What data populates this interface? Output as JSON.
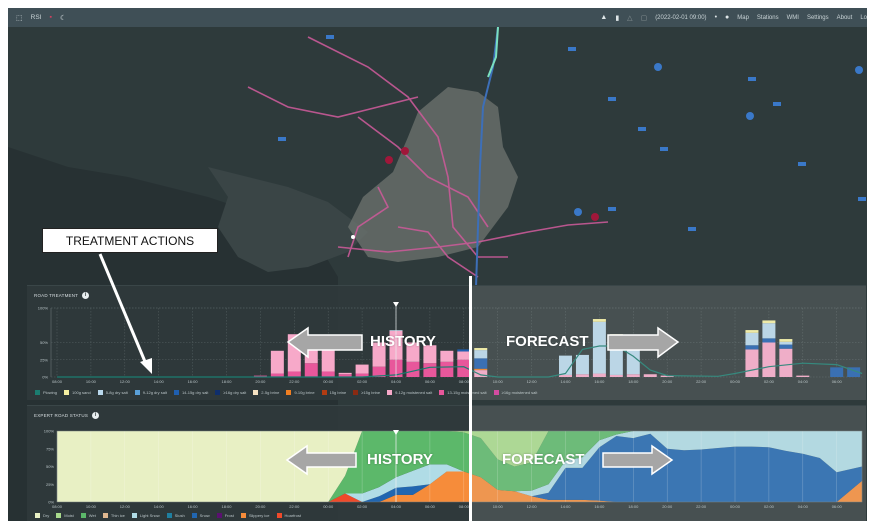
{
  "topbar": {
    "app_name": "RSI",
    "station_time": "(2022-02-01 09:00)",
    "nav": [
      "Map",
      "Stations",
      "WMI",
      "Settings",
      "About",
      "Lo"
    ],
    "icons": [
      "rsi-logo-icon",
      "flag-icon",
      "moon-icon",
      "car-icon",
      "truck-icon",
      "warning-icon",
      "calendar-icon",
      "dot-icon",
      "globe-icon"
    ]
  },
  "annotations": {
    "callout": "TREATMENT ACTIONS",
    "history": "HISTORY",
    "forecast": "FORECAST"
  },
  "chart_data": [
    {
      "type": "bar",
      "title": "ROAD TREATMENT",
      "stacked": true,
      "x_ticks": [
        "08:00",
        "10:00",
        "12:00",
        "14:00",
        "16:00",
        "18:00",
        "20:00",
        "22:00",
        "00:00",
        "02:00",
        "04:00",
        "06:00",
        "08:00",
        "10:00",
        "12:00",
        "14:00",
        "16:00",
        "18:00",
        "20:00",
        "22:00",
        "00:00",
        "02:00",
        "04:00",
        "06:00"
      ],
      "y_ticks": [
        "0%",
        "25%",
        "50%",
        "100%"
      ],
      "ylim": [
        0,
        100
      ],
      "grid": true,
      "now_marker": "04:00",
      "legend": [
        {
          "name": "Plowing",
          "color": "#1b7d70"
        },
        {
          "name": "100g sand",
          "color": "#f6f0a2"
        },
        {
          "name": "5-8g dry salt",
          "color": "#b9d8ec"
        },
        {
          "name": "9-12g dry salt",
          "color": "#5aa0d8"
        },
        {
          "name": "14-15g dry salt",
          "color": "#1f5fb0"
        },
        {
          "name": "≥16g dry salt",
          "color": "#0f2e6c"
        },
        {
          "name": "2-5g brine",
          "color": "#f5e2c2"
        },
        {
          "name": "9-10g brine",
          "color": "#f07f22"
        },
        {
          "name": "15g brine",
          "color": "#b23c12"
        },
        {
          "name": "≥15g brine",
          "color": "#8a2a12"
        },
        {
          "name": "9-12g moistened salt",
          "color": "#f7a9c9"
        },
        {
          "name": "13-15g moistened salt",
          "color": "#e8579b"
        },
        {
          "name": "≥16g moistened salt",
          "color": "#d6349a"
        }
      ],
      "bars": [
        {
          "time": "20:00",
          "h": 12,
          "seg": {
            "13-15g moistened salt": 2
          }
        },
        {
          "time": "21:00",
          "h": 13,
          "seg": {
            "13-15g moistened salt": 5,
            "9-12g moistened salt": 33
          }
        },
        {
          "time": "22:00",
          "h": 14,
          "seg": {
            "13-15g moistened salt": 8,
            "9-12g moistened salt": 54
          }
        },
        {
          "time": "23:00",
          "h": 15,
          "seg": {
            "13-15g moistened salt": 20,
            "9-12g moistened salt": 28
          }
        },
        {
          "time": "00:00",
          "h": 16,
          "seg": {
            "13-15g moistened salt": 8,
            "9-12g moistened salt": 34
          }
        },
        {
          "time": "01:00",
          "h": 17,
          "seg": {
            "13-15g moistened salt": 4,
            "9-12g moistened salt": 2
          }
        },
        {
          "time": "02:00",
          "h": 18,
          "seg": {
            "13-15g moistened salt": 5,
            "9-12g moistened salt": 13
          }
        },
        {
          "time": "03:00",
          "h": 19,
          "seg": {
            "13-15g moistened salt": 15,
            "9-12g moistened salt": 35
          }
        },
        {
          "time": "04:00",
          "h": 20,
          "seg": {
            "13-15g moistened salt": 25,
            "9-12g moistened salt": 42,
            "5-8g dry salt": 1
          }
        },
        {
          "time": "05:00",
          "h": 21,
          "seg": {
            "13-15g moistened salt": 22,
            "9-12g moistened salt": 28
          }
        },
        {
          "time": "06:00",
          "h": 22,
          "seg": {
            "13-15g moistened salt": 20,
            "9-12g moistened salt": 26
          }
        },
        {
          "time": "07:00",
          "h": 23,
          "seg": {
            "13-15g moistened salt": 22,
            "9-12g moistened salt": 16
          }
        },
        {
          "time": "08:00",
          "h": 24,
          "seg": {
            "13-15g moistened salt": 25,
            "9-12g moistened salt": 12,
            "14-15g dry salt": 3
          }
        },
        {
          "time": "09:00",
          "h": 25,
          "seg": {
            "9-12g moistened salt": 10,
            "9-10g brine": 2,
            "14-15g dry salt": 15,
            "5-8g dry salt": 12,
            "100g sand": 3
          }
        },
        {
          "time": "14:00",
          "h": 30,
          "seg": {
            "9-12g moistened salt": 3,
            "5-8g dry salt": 28
          }
        },
        {
          "time": "15:00",
          "h": 31,
          "seg": {
            "9-12g moistened salt": 4,
            "5-8g dry salt": 28
          }
        },
        {
          "time": "16:00",
          "h": 32,
          "seg": {
            "9-12g moistened salt": 5,
            "5-8g dry salt": 75,
            "100g sand": 4
          }
        },
        {
          "time": "17:00",
          "h": 33,
          "seg": {
            "9-12g moistened salt": 3,
            "5-8g dry salt": 56,
            "100g sand": 3
          }
        },
        {
          "time": "18:00",
          "h": 34,
          "seg": {
            "9-12g moistened salt": 4,
            "5-8g dry salt": 46
          }
        },
        {
          "time": "19:00",
          "h": 35,
          "seg": {
            "9-12g moistened salt": 4
          }
        },
        {
          "time": "20:00",
          "h": 36,
          "seg": {
            "9-12g moistened salt": 2
          }
        },
        {
          "time": "01:00",
          "h": 41,
          "seg": {
            "9-12g moistened salt": 40,
            "14-15g dry salt": 6,
            "5-8g dry salt": 18,
            "100g sand": 4
          }
        },
        {
          "time": "02:00",
          "h": 42,
          "seg": {
            "9-12g moistened salt": 50,
            "14-15g dry salt": 6,
            "5-8g dry salt": 22,
            "100g sand": 4
          }
        },
        {
          "time": "03:00",
          "h": 43,
          "seg": {
            "9-12g moistened salt": 41,
            "14-15g dry salt": 6,
            "5-8g dry salt": 4,
            "100g sand": 4
          }
        },
        {
          "time": "04:00",
          "h": 44,
          "seg": {
            "9-12g moistened salt": 2
          }
        },
        {
          "time": "06:00",
          "h": 46,
          "seg": {
            "14-15g dry salt": 14
          }
        },
        {
          "time": "07:00",
          "h": 47,
          "seg": {
            "14-15g dry salt": 14
          }
        }
      ],
      "plowing_line": [
        [
          0,
          0
        ],
        [
          18,
          0
        ],
        [
          20,
          3
        ],
        [
          22,
          14
        ],
        [
          24,
          15
        ],
        [
          25,
          3
        ],
        [
          26,
          0
        ],
        [
          29,
          0
        ],
        [
          30,
          5
        ],
        [
          31,
          40
        ],
        [
          32,
          45
        ],
        [
          33,
          45
        ],
        [
          34,
          30
        ],
        [
          35,
          10
        ],
        [
          36,
          2
        ],
        [
          39,
          1
        ],
        [
          40,
          5
        ],
        [
          42,
          15
        ],
        [
          44,
          20
        ],
        [
          46,
          18
        ],
        [
          47.5,
          5
        ]
      ]
    },
    {
      "type": "area",
      "title": "EXPERT ROAD STATUS",
      "stacked": true,
      "ylim": [
        0,
        100
      ],
      "x_ticks": [
        "08:00",
        "10:00",
        "12:00",
        "14:00",
        "16:00",
        "18:00",
        "20:00",
        "22:00",
        "00:00",
        "02:00",
        "04:00",
        "06:00",
        "08:00",
        "10:00",
        "12:00",
        "14:00",
        "16:00",
        "18:00",
        "20:00",
        "22:00",
        "00:00",
        "02:00",
        "04:00",
        "06:00"
      ],
      "y_ticks": [
        "0%",
        "25%",
        "50%",
        "75%",
        "100%"
      ],
      "now_marker": "04:00",
      "legend": [
        {
          "name": "Dry",
          "color": "#e8f0c4"
        },
        {
          "name": "Moist",
          "color": "#a8da8c"
        },
        {
          "name": "Wet",
          "color": "#5cb86a"
        },
        {
          "name": "Thin ice",
          "color": "#e0b890"
        },
        {
          "name": "Light Snow",
          "color": "#b0dce6"
        },
        {
          "name": "Slush",
          "color": "#1f7fa0"
        },
        {
          "name": "Snow",
          "color": "#2166b0"
        },
        {
          "name": "Frost",
          "color": "#5a1070"
        },
        {
          "name": "Slippery ice",
          "color": "#f68c3a"
        },
        {
          "name": "Hoarfrost",
          "color": "#f04a2a"
        }
      ],
      "stack_order": [
        "Hoarfrost",
        "Slippery ice",
        "Snow",
        "Light Snow",
        "Wet",
        "Moist",
        "Dry"
      ],
      "points": [
        {
          "h": 0,
          "Dry": 100
        },
        {
          "h": 16,
          "Dry": 100
        },
        {
          "h": 17,
          "Hoarfrost": 12,
          "Wet": 25,
          "Dry": 63
        },
        {
          "h": 18,
          "Light Snow": 12,
          "Wet": 88
        },
        {
          "h": 19,
          "Snow": 8,
          "Light Snow": 13,
          "Wet": 79
        },
        {
          "h": 20,
          "Slippery ice": 10,
          "Snow": 10,
          "Light Snow": 15,
          "Wet": 65
        },
        {
          "h": 21,
          "Slippery ice": 10,
          "Snow": 12,
          "Light Snow": 22,
          "Wet": 56
        },
        {
          "h": 22,
          "Slippery ice": 25,
          "Light Snow": 28,
          "Wet": 47
        },
        {
          "h": 23,
          "Slippery ice": 43,
          "Light Snow": 10,
          "Wet": 47
        },
        {
          "h": 24,
          "Slippery ice": 43,
          "Wet": 55,
          "Moist": 2
        },
        {
          "h": 25,
          "Slippery ice": 35,
          "Wet": 55,
          "Moist": 10
        },
        {
          "h": 26,
          "Slippery ice": 17,
          "Wet": 43,
          "Moist": 40
        },
        {
          "h": 27,
          "Slippery ice": 15,
          "Wet": 35,
          "Moist": 50
        },
        {
          "h": 28,
          "Slippery ice": 8,
          "Light Snow": 8,
          "Wet": 40,
          "Moist": 44
        },
        {
          "h": 29,
          "Slippery ice": 3,
          "Snow": 10,
          "Light Snow": 12,
          "Wet": 75
        },
        {
          "h": 30,
          "Slippery ice": 3,
          "Snow": 45,
          "Light Snow": 10,
          "Wet": 42
        },
        {
          "h": 31,
          "Slippery ice": 3,
          "Snow": 45,
          "Light Snow": 15,
          "Wet": 37
        },
        {
          "h": 32,
          "Slippery ice": 2,
          "Snow": 75,
          "Light Snow": 10,
          "Wet": 13
        },
        {
          "h": 33,
          "Snow": 93,
          "Light Snow": 2,
          "Wet": 5
        },
        {
          "h": 34,
          "Snow": 90,
          "Light Snow": 10
        },
        {
          "h": 35,
          "Snow": 96,
          "Light Snow": 4
        },
        {
          "h": 36,
          "Snow": 75,
          "Light Snow": 25
        },
        {
          "h": 37,
          "Snow": 73,
          "Light Snow": 27
        },
        {
          "h": 38,
          "Snow": 74,
          "Light Snow": 26
        },
        {
          "h": 39,
          "Snow": 76,
          "Light Snow": 24
        },
        {
          "h": 40,
          "Snow": 78,
          "Light Snow": 22
        },
        {
          "h": 41,
          "Snow": 78,
          "Light Snow": 22
        },
        {
          "h": 42,
          "Snow": 77,
          "Light Snow": 23
        },
        {
          "h": 43,
          "Snow": 72,
          "Light Snow": 28
        },
        {
          "h": 44,
          "Snow": 68,
          "Light Snow": 32
        },
        {
          "h": 45,
          "Snow": 62,
          "Light Snow": 38
        },
        {
          "h": 46,
          "Snow": 42,
          "Light Snow": 58
        },
        {
          "h": 47.5,
          "Slippery ice": 30,
          "Snow": 20,
          "Light Snow": 50
        }
      ]
    }
  ]
}
